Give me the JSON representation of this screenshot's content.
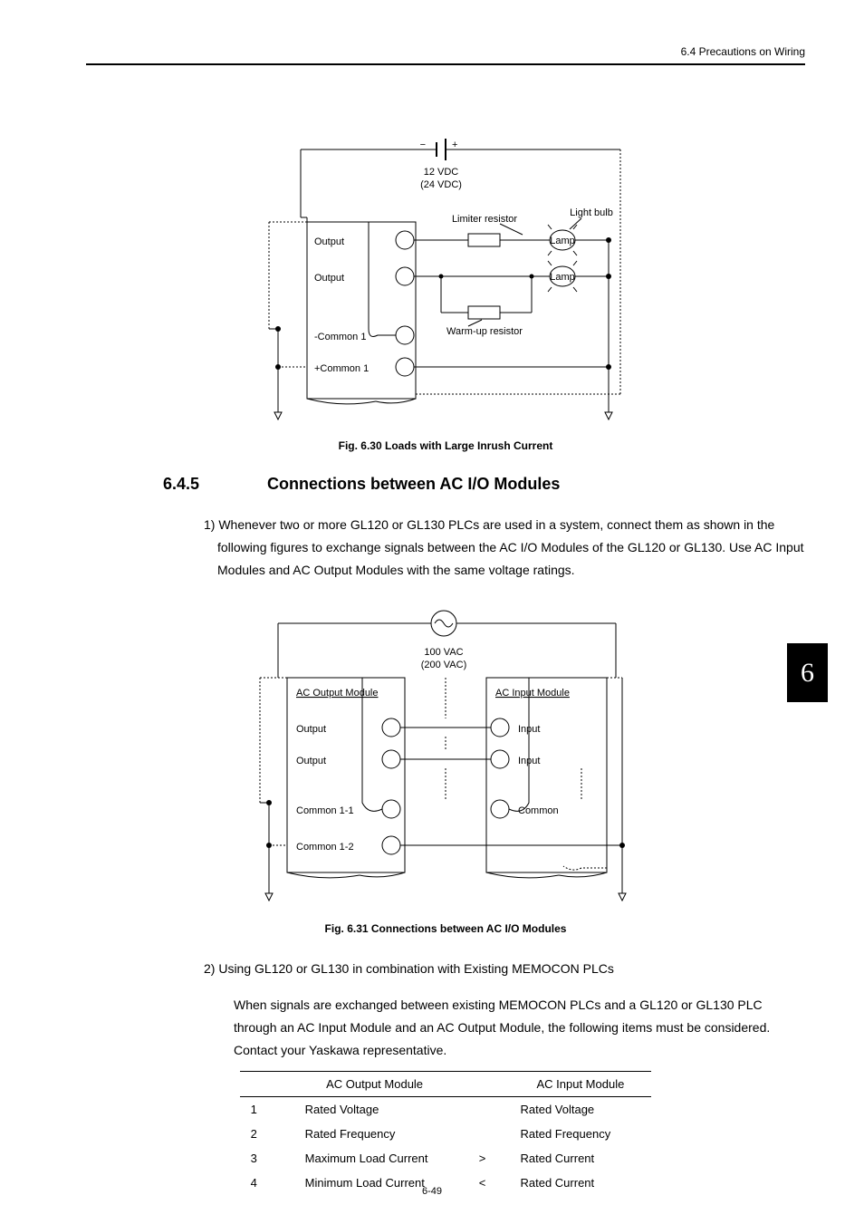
{
  "header": {
    "breadcrumb": "6.4  Precautions on Wiring"
  },
  "chapter_tab": "6",
  "figure_30": {
    "voltage_main": "12 VDC",
    "voltage_alt": "(24 VDC)",
    "limiter_resistor": "Limiter resistor",
    "light_bulb": "Light bulb",
    "lamp": "Lamp",
    "output1": "Output",
    "output2": "Output",
    "warm_up_resistor": "Warm-up resistor",
    "minus_common": "-Common 1",
    "plus_common": "+Common 1",
    "caption": "Fig. 6.30  Loads with Large Inrush Current"
  },
  "section": {
    "number": "6.4.5",
    "title": "Connections between AC I/O Modules"
  },
  "para1": "1) Whenever two or more GL120 or GL130 PLCs are used in a system, connect them as shown in the following figures to exchange signals between the AC I/O Modules of the GL120 or GL130.  Use AC Input Modules and AC Output Modules with the same voltage ratings.",
  "figure_31": {
    "voltage_main": "100 VAC",
    "voltage_alt": "(200 VAC)",
    "ac_output_module": "AC Output Module",
    "ac_input_module": "AC Input Module",
    "output1": "Output",
    "output2": "Output",
    "input1": "Input",
    "input2": "Input",
    "common_11": "Common 1-1",
    "common_12": "Common 1-2",
    "common": "Common",
    "caption": "Fig. 6.31  Connections between AC I/O Modules"
  },
  "para2_head": "2) Using GL120 or GL130 in combination with Existing MEMOCON PLCs",
  "para2_body": "When signals are exchanged between existing MEMOCON PLCs and a GL120 or GL130 PLC through an AC Input Module and an AC Output Module, the following items must be considered. Contact your Yaskawa representative.",
  "table": {
    "headers": {
      "h1": "AC Output Module",
      "h2": "",
      "h3": "AC Input Module"
    },
    "rows": [
      {
        "n": "1",
        "out": "Rated Voltage",
        "op": "",
        "in": "Rated Voltage"
      },
      {
        "n": "2",
        "out": "Rated Frequency",
        "op": "",
        "in": "Rated Frequency"
      },
      {
        "n": "3",
        "out": "Maximum Load Current",
        "op": ">",
        "in": "Rated Current"
      },
      {
        "n": "4",
        "out": "Minimum Load Current",
        "op": "<",
        "in": "Rated Current"
      }
    ]
  },
  "page_number": "6-49"
}
